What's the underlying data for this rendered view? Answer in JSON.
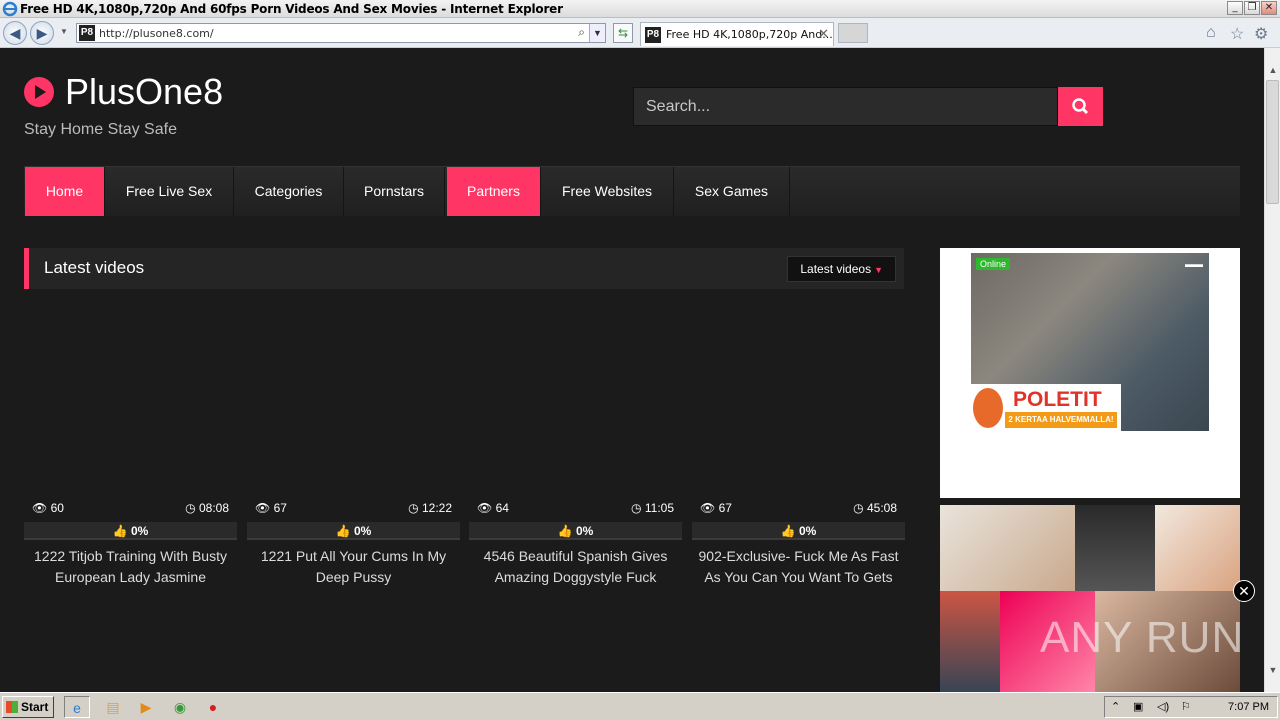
{
  "browser": {
    "window_title": "Free HD 4K,1080p,720p And 60fps Porn Videos And Sex Movies - Internet Explorer",
    "url": "http://plusone8.com/",
    "favicon_text": "P8",
    "tab_title": "Free HD 4K,1080p,720p And...",
    "minimize": "0",
    "restore": "1",
    "close": "r"
  },
  "site": {
    "name": "PlusOne8",
    "tagline": "Stay Home Stay Safe",
    "search_placeholder": "Search..."
  },
  "menu": [
    {
      "label": "Home",
      "active": true
    },
    {
      "label": "Free Live Sex",
      "active": false
    },
    {
      "label": "Categories",
      "active": false
    },
    {
      "label": "Pornstars",
      "active": false
    },
    {
      "label": "Partners",
      "active": true
    },
    {
      "label": "Free Websites",
      "active": false
    },
    {
      "label": "Sex Games",
      "active": false
    }
  ],
  "section": {
    "heading": "Latest videos",
    "sort_label": "Latest videos"
  },
  "videos": [
    {
      "views": "60",
      "duration": "08:08",
      "rating": "0%",
      "title": "1222 Titjob Training With Busty European Lady Jasmine"
    },
    {
      "views": "67",
      "duration": "12:22",
      "rating": "0%",
      "title": "1221 Put All Your Cums In My Deep Pussy"
    },
    {
      "views": "64",
      "duration": "11:05",
      "rating": "0%",
      "title": "4546 Beautiful Spanish Gives Amazing Doggystyle Fuck"
    },
    {
      "views": "67",
      "duration": "45:08",
      "rating": "0%",
      "title": "902-Exclusive- Fuck Me As Fast As You Can You Want To Gets"
    }
  ],
  "ads": {
    "cam_status": "Online",
    "banner_title": "POLETIT",
    "banner_sub": "2 KERTAA HALVEMMALLA!"
  },
  "watermark": "ANY RUN",
  "taskbar": {
    "start": "Start",
    "time": "7:07 PM"
  },
  "colors": {
    "accent": "#ff3565",
    "background": "#1b1b1c"
  }
}
